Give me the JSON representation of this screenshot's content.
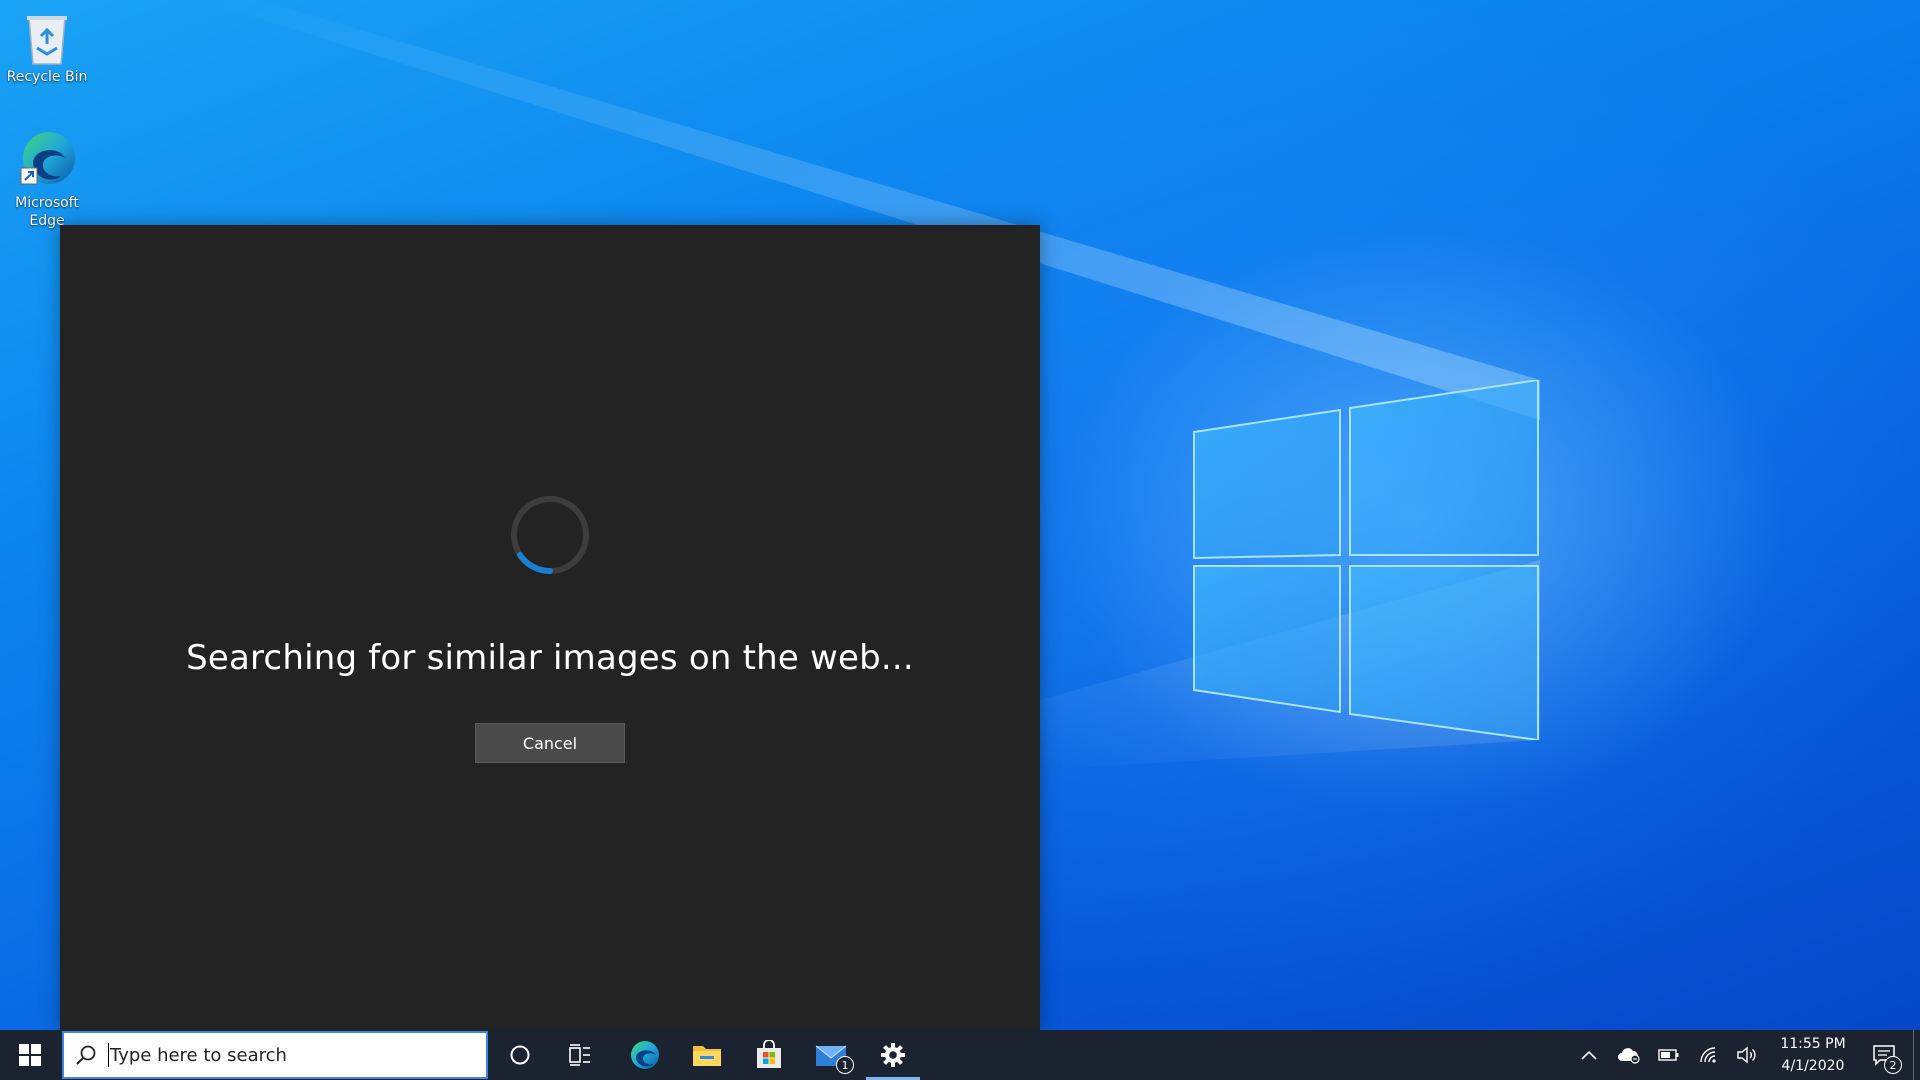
{
  "desktop": {
    "icons": [
      {
        "label": "Recycle Bin",
        "icon": "recycle-bin-icon"
      },
      {
        "label": "Microsoft Edge",
        "icon": "edge-icon"
      }
    ]
  },
  "dialog": {
    "status_text": "Searching for similar images on the web...",
    "cancel_label": "Cancel",
    "spinner": "loading-spinner"
  },
  "taskbar": {
    "search_placeholder": "Type here to search",
    "apps": [
      {
        "name": "Cortana",
        "icon": "cortana-circle-icon"
      },
      {
        "name": "Task View",
        "icon": "task-view-icon"
      },
      {
        "name": "Microsoft Edge",
        "icon": "edge-icon"
      },
      {
        "name": "File Explorer",
        "icon": "folder-icon"
      },
      {
        "name": "Microsoft Store",
        "icon": "store-bag-icon"
      },
      {
        "name": "Mail",
        "icon": "mail-icon",
        "badge": "1"
      },
      {
        "name": "Settings",
        "icon": "gear-icon",
        "active": true
      }
    ],
    "tray": {
      "clock_time": "11:55 PM",
      "clock_date": "4/1/2020",
      "notification_count": "2"
    }
  },
  "colors": {
    "dialog_bg": "#232323",
    "taskbar_bg": "#1c2330",
    "accent": "#0078d7",
    "button_bg": "#4a4a4a"
  }
}
